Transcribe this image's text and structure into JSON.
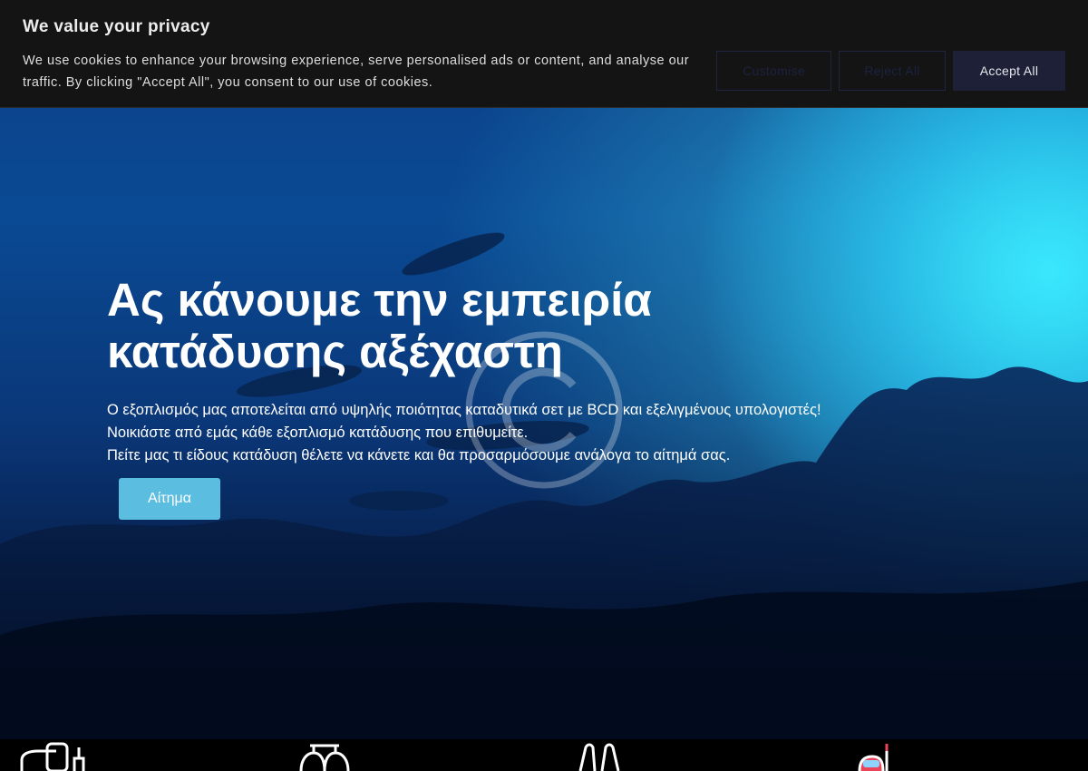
{
  "cookie_banner": {
    "title": "We value your privacy",
    "text": "We use cookies to enhance your browsing experience, serve personalised ads or content, and analyse our traffic. By clicking \"Accept All\", you consent to our use of cookies.",
    "customise_label": "Customise",
    "reject_label": "Reject All",
    "accept_label": "Accept All"
  },
  "hero": {
    "title": "Ας κάνουμε την εμπειρία κατάδυσης αξέχαστη",
    "lines": [
      "Ο εξοπλισμός μας αποτελείται από υψηλής ποιότητας καταδυτικά σετ με BCD και εξελιγμένους υπολογιστές!",
      "Νοικιάστε από εμάς κάθε εξοπλισμό κατάδυσης που επιθυμείτε.",
      "Πείτε μας τι είδους κατάδυση θέλετε να κάνετε και θα προσαρμόσουμε ανάλογα το αίτημά σας."
    ],
    "cta_label": "Αίτημα"
  },
  "colors": {
    "cookie_bg": "#141414",
    "accept_bg": "#1d2036",
    "cta_bg": "#5bbde0",
    "hero_deep": "#061c45",
    "hero_light": "#28e6ff"
  },
  "icons": {
    "watermark": "copyright-watermark-icon",
    "strip": [
      "diver-gear-icon",
      "oxygen-tanks-icon",
      "fins-icon",
      "snorkel-mask-icon"
    ]
  }
}
